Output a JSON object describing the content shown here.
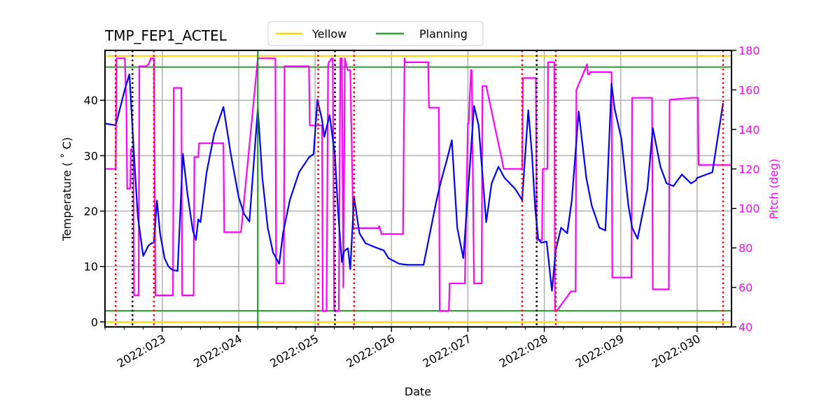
{
  "chart_data": {
    "type": "line",
    "title": "TMP_FEP1_ACTEL",
    "xlabel": "Date",
    "ylabel": "Temperature ($^\\circ$C)",
    "ylabel_display": "Temperature ( ˚ C)",
    "y2label": "Pitch (deg)",
    "xlim": [
      22.25,
      30.45
    ],
    "ylim": [
      -0.9,
      49.0
    ],
    "y2lim": [
      40,
      180
    ],
    "grid": true,
    "legend": {
      "placement": "top-center-outside",
      "entries": [
        {
          "label": "Yellow",
          "color": "#ffd700"
        },
        {
          "label": "Planning",
          "color": "#2ca02c"
        }
      ]
    },
    "x_ticks": [
      {
        "value": 23,
        "label": "2022:023"
      },
      {
        "value": 24,
        "label": "2022:024"
      },
      {
        "value": 25,
        "label": "2022:025"
      },
      {
        "value": 26,
        "label": "2022:026"
      },
      {
        "value": 27,
        "label": "2022:027"
      },
      {
        "value": 28,
        "label": "2022:028"
      },
      {
        "value": 29,
        "label": "2022:029"
      },
      {
        "value": 30,
        "label": "2022:030"
      }
    ],
    "y_ticks": [
      0,
      10,
      20,
      30,
      40
    ],
    "y2_ticks": [
      40,
      60,
      80,
      100,
      120,
      140,
      160,
      180
    ],
    "limits": [
      {
        "name": "yellow-high",
        "value": 48.0,
        "color": "#ffd700"
      },
      {
        "name": "yellow-low",
        "value": 0.0,
        "color": "#ffd700"
      },
      {
        "name": "planning-high",
        "value": 46.0,
        "color": "#2ca02c"
      },
      {
        "name": "planning-low",
        "value": 2.0,
        "color": "#2ca02c"
      }
    ],
    "vertical_markers": {
      "red_dotted": [
        22.39,
        22.89,
        25.04,
        25.51,
        27.71,
        28.15,
        30.34
      ],
      "black_dotted": [
        22.61,
        25.26,
        27.9
      ],
      "green_solid": [
        24.25
      ]
    },
    "series": [
      {
        "name": "Temperature",
        "axis": "left",
        "color": "#0000ff",
        "x": [
          22.25,
          22.39,
          22.51,
          22.57,
          22.63,
          22.68,
          22.75,
          22.82,
          22.86,
          22.89,
          22.93,
          22.97,
          23.03,
          23.08,
          23.13,
          23.2,
          23.27,
          23.33,
          23.4,
          23.44,
          23.47,
          23.5,
          23.58,
          23.68,
          23.8,
          23.9,
          24.0,
          24.07,
          24.14,
          24.25,
          24.31,
          24.38,
          24.45,
          24.53,
          24.58,
          24.67,
          24.79,
          24.92,
          24.98,
          25.03,
          25.09,
          25.12,
          25.19,
          25.26,
          25.3,
          25.35,
          25.38,
          25.43,
          25.46,
          25.51,
          25.58,
          25.66,
          25.78,
          25.86,
          25.9,
          25.96,
          26.1,
          26.15,
          26.22,
          26.32,
          26.42,
          26.59,
          26.65,
          26.72,
          26.79,
          26.86,
          26.94,
          27.01,
          27.08,
          27.14,
          27.24,
          27.31,
          27.4,
          27.48,
          27.62,
          27.71,
          27.79,
          27.84,
          27.88,
          27.92,
          27.96,
          28.03,
          28.1,
          28.15,
          28.22,
          28.3,
          28.36,
          28.45,
          28.55,
          28.62,
          28.72,
          28.8,
          28.88,
          28.92,
          29.01,
          29.1,
          29.15,
          29.22,
          29.35,
          29.42,
          29.52,
          29.6,
          29.69,
          29.8,
          29.92,
          29.98,
          30.0,
          30.1,
          30.2,
          30.34,
          30.45
        ],
        "y": [
          35.8,
          35.5,
          42.0,
          44.7,
          30.0,
          19.0,
          11.9,
          13.8,
          14.2,
          14.3,
          21.9,
          16.0,
          11.5,
          10.0,
          9.4,
          9.2,
          30.3,
          23.0,
          16.5,
          14.8,
          18.5,
          18.0,
          27.0,
          34.0,
          38.8,
          30.0,
          22.5,
          19.5,
          18.1,
          38.5,
          26.0,
          17.0,
          12.5,
          10.5,
          16.0,
          22.0,
          27.0,
          29.7,
          30.3,
          40.1,
          36.5,
          33.4,
          37.3,
          30.0,
          20.0,
          10.8,
          12.8,
          13.3,
          9.5,
          22.5,
          16.0,
          14.2,
          13.5,
          13.1,
          12.9,
          11.5,
          10.5,
          10.4,
          10.3,
          10.3,
          10.3,
          22.0,
          25.5,
          29.0,
          32.8,
          17.0,
          11.5,
          25.0,
          39.0,
          35.5,
          18.0,
          25.0,
          28.0,
          26.0,
          24.0,
          22.0,
          38.2,
          30.0,
          20.5,
          15.0,
          14.3,
          14.5,
          5.6,
          13.0,
          17.0,
          16.0,
          22.0,
          38.0,
          26.0,
          21.0,
          17.0,
          16.5,
          43.0,
          38.5,
          33.0,
          21.0,
          17.0,
          15.0,
          24.0,
          35.0,
          28.0,
          25.0,
          24.5,
          26.6,
          25.0,
          25.5,
          26.0,
          26.5,
          27.0,
          39.5
        ],
        "y_note": "values approximated from gridlines"
      },
      {
        "name": "Pitch",
        "axis": "right",
        "color": "#ff00ff",
        "x": [
          22.25,
          22.38,
          22.39,
          22.4,
          22.51,
          22.53,
          22.54,
          22.56,
          22.58,
          22.59,
          22.6,
          22.62,
          22.63,
          22.64,
          22.67,
          22.69,
          22.7,
          22.79,
          22.82,
          22.85,
          22.86,
          22.89,
          22.91,
          23.14,
          23.15,
          23.25,
          23.26,
          23.29,
          23.3,
          23.41,
          23.42,
          23.47,
          23.48,
          23.5,
          23.52,
          23.8,
          23.81,
          24.02,
          24.03,
          24.25,
          24.26,
          24.48,
          24.49,
          24.52,
          24.53,
          24.59,
          24.6,
          24.92,
          24.93,
          25.08,
          25.09,
          25.1,
          25.13,
          25.15,
          25.17,
          25.18,
          25.22,
          25.23,
          25.25,
          25.28,
          25.3,
          25.31,
          25.33,
          25.35,
          25.37,
          25.39,
          25.41,
          25.43,
          25.46,
          25.5,
          25.52,
          25.53,
          25.83,
          25.84,
          25.87,
          25.88,
          26.14,
          26.15,
          26.17,
          26.18,
          26.24,
          26.25,
          26.48,
          26.49,
          26.59,
          26.62,
          26.63,
          26.75,
          26.76,
          26.96,
          27.0,
          27.01,
          27.04,
          27.05,
          27.08,
          27.09,
          27.18,
          27.19,
          27.23,
          27.24,
          27.47,
          27.48,
          27.71,
          27.72,
          27.89,
          27.9,
          27.93,
          27.94,
          27.97,
          27.98,
          28.04,
          28.05,
          28.12,
          28.13,
          28.14,
          28.15,
          28.16,
          28.35,
          28.36,
          28.37,
          28.41,
          28.42,
          28.56,
          28.57,
          28.59,
          28.6,
          28.88,
          28.89,
          29.09,
          29.1,
          29.14,
          29.15,
          29.21,
          29.22,
          29.41,
          29.42,
          29.44,
          29.45,
          29.63,
          29.64,
          29.94,
          29.95,
          30.01,
          30.02,
          30.34,
          30.35,
          30.45
        ],
        "y": [
          120,
          120,
          120,
          176,
          176,
          150,
          110,
          110,
          110,
          130,
          130,
          130,
          56,
          56,
          56,
          56,
          172,
          172,
          173,
          176,
          176,
          176,
          56,
          56,
          161,
          161,
          56,
          56,
          56,
          56,
          126,
          126,
          133,
          133,
          133,
          133,
          88,
          88,
          88,
          176,
          176,
          176,
          62,
          62,
          62,
          62,
          172,
          172,
          142,
          142,
          142,
          48,
          48,
          48,
          172,
          174,
          176,
          176,
          48,
          48,
          48,
          48,
          176,
          176,
          60,
          176,
          172,
          170,
          170,
          90,
          90,
          90,
          90,
          91,
          87,
          87,
          87,
          87,
          176,
          174,
          174,
          174,
          174,
          151,
          151,
          151,
          48,
          48,
          62,
          62,
          143,
          143,
          170,
          170,
          62,
          62,
          62,
          162,
          162,
          162,
          120,
          120,
          120,
          166,
          166,
          84,
          84,
          84,
          84,
          120,
          120,
          174,
          174,
          174,
          48,
          48,
          48,
          58,
          58,
          58,
          58,
          160,
          173,
          168,
          168,
          169,
          169,
          65,
          65,
          65,
          65,
          156,
          156,
          156,
          156,
          59,
          59,
          59,
          59,
          155,
          156,
          156,
          156,
          122,
          122,
          122,
          122,
          162,
          162,
          132,
          132,
          170,
          170
        ],
        "y_note": "values approximated from gridlines"
      }
    ]
  }
}
